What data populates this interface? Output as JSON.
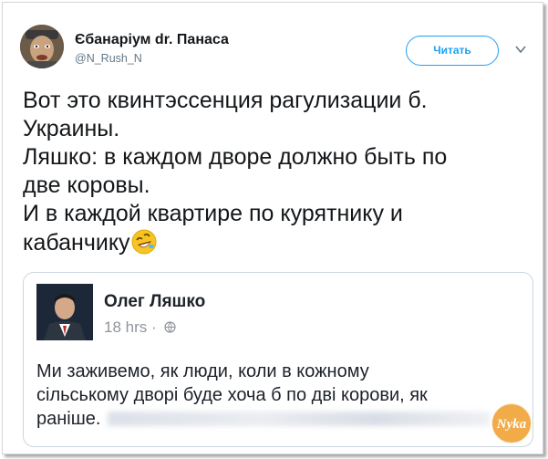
{
  "tweet": {
    "display_name": "Єбанаріум dr. Панаса",
    "handle": "@N_Rush_N",
    "follow_label": "Читать",
    "menu_icon": "chevron-down-icon",
    "text_lines": [
      "Вот это квинтэссенция рагулизации б.",
      "Украины.",
      "Ляшко: в каждом дворе должно быть по",
      "две коровы.",
      "И в каждой квартире по курятнику и",
      "кабанчику"
    ],
    "emoji": "rolling-on-floor-laughing-emoji"
  },
  "quoted_post": {
    "author": "Олег Ляшко",
    "time": "18 hrs ·",
    "privacy_icon": "globe-icon",
    "text_lines": [
      "Ми заживемо, як люди, коли в кожному",
      "сільському дворі буде хоча б по дві корови, як",
      "раніше."
    ]
  },
  "watermark": {
    "label": "Nyka"
  },
  "colors": {
    "accent": "#1da1f2",
    "border": "#ccd6dd",
    "muted": "#657786"
  }
}
